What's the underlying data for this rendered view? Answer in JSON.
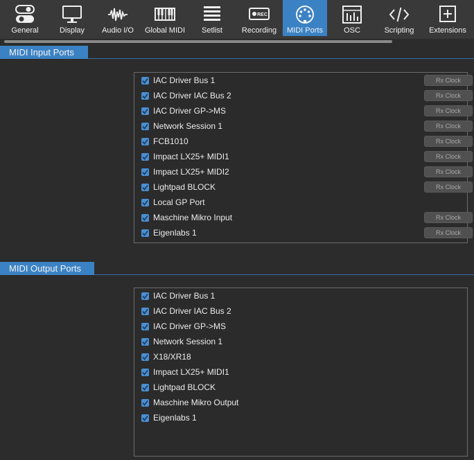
{
  "toolbar": {
    "tabs": [
      {
        "id": "general",
        "label": "General",
        "icon": "toggle-switches-icon",
        "active": false
      },
      {
        "id": "display",
        "label": "Display",
        "icon": "monitor-icon",
        "active": false
      },
      {
        "id": "audio",
        "label": "Audio I/O",
        "icon": "waveform-icon",
        "active": false
      },
      {
        "id": "globalmidi",
        "label": "Global MIDI",
        "icon": "piano-keyboard-icon",
        "active": false
      },
      {
        "id": "setlist",
        "label": "Setlist",
        "icon": "list-icon",
        "active": false
      },
      {
        "id": "recording",
        "label": "Recording",
        "icon": "rec-icon",
        "active": false
      },
      {
        "id": "midiports",
        "label": "MIDI Ports",
        "icon": "midi-connector-icon",
        "active": true
      },
      {
        "id": "osc",
        "label": "OSC",
        "icon": "mixer-icon",
        "active": false
      },
      {
        "id": "scripting",
        "label": "Scripting",
        "icon": "code-icon",
        "active": false
      },
      {
        "id": "extensions",
        "label": "Extensions",
        "icon": "plus-box-icon",
        "active": false
      }
    ],
    "rec_badge": "REC"
  },
  "colors": {
    "accent": "#3b82c4",
    "background": "#2c2c2c",
    "toolbar": "#393939",
    "checkbox": "#4a8fd3"
  },
  "input_section": {
    "title": "MIDI Input Ports",
    "ports": [
      {
        "name": "IAC Driver Bus 1",
        "checked": true,
        "button": "Rx Clock"
      },
      {
        "name": "IAC Driver IAC Bus 2",
        "checked": true,
        "button": "Rx Clock"
      },
      {
        "name": "IAC Driver GP->MS",
        "checked": true,
        "button": "Rx Clock"
      },
      {
        "name": "Network Session 1",
        "checked": true,
        "button": "Rx Clock"
      },
      {
        "name": "FCB1010",
        "checked": true,
        "button": "Rx Clock"
      },
      {
        "name": "Impact LX25+ MIDI1",
        "checked": true,
        "button": "Rx Clock"
      },
      {
        "name": "Impact LX25+ MIDI2",
        "checked": true,
        "button": "Rx Clock"
      },
      {
        "name": "Lightpad BLOCK",
        "checked": true,
        "button": "Rx Clock"
      },
      {
        "name": "Local GP Port",
        "checked": true,
        "button": null
      },
      {
        "name": "Maschine Mikro Input",
        "checked": true,
        "button": "Rx Clock"
      },
      {
        "name": "Eigenlabs 1",
        "checked": true,
        "button": "Rx Clock"
      }
    ]
  },
  "output_section": {
    "title": "MIDI Output Ports",
    "ports": [
      {
        "name": "IAC Driver Bus 1",
        "checked": true
      },
      {
        "name": "IAC Driver IAC Bus 2",
        "checked": true
      },
      {
        "name": "IAC Driver GP->MS",
        "checked": true
      },
      {
        "name": "Network Session 1",
        "checked": true
      },
      {
        "name": "X18/XR18",
        "checked": true
      },
      {
        "name": "Impact LX25+ MIDI1",
        "checked": true
      },
      {
        "name": "Lightpad BLOCK",
        "checked": true
      },
      {
        "name": "Maschine Mikro Output",
        "checked": true
      },
      {
        "name": "Eigenlabs 1",
        "checked": true
      }
    ]
  }
}
